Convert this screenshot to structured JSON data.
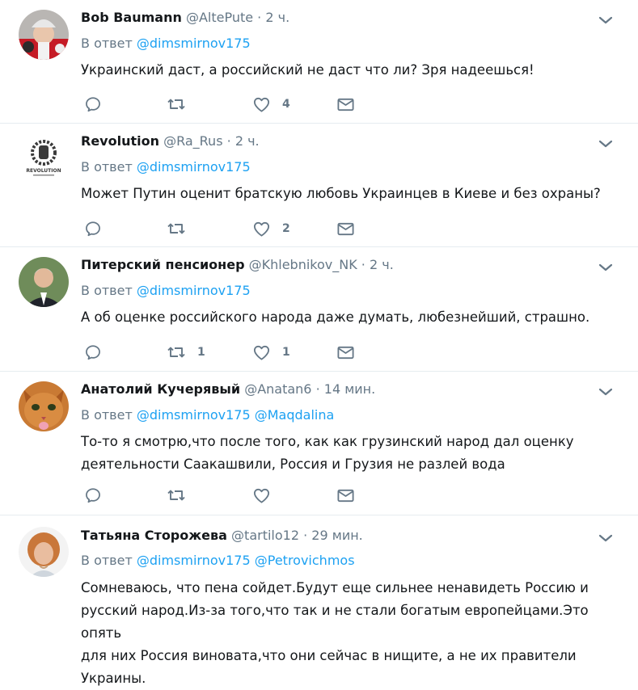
{
  "reply_prefix": "В ответ",
  "tweets": [
    {
      "name": "Bob Baumann",
      "handle": "@AltePute",
      "dot": "·",
      "time": "2 ч.",
      "mentions": [
        "@dimsmirnov175"
      ],
      "text": "Украинский даст, а российский не даст что ли? Зря надеешься!",
      "reply_count": "",
      "retweet_count": "",
      "like_count": "4"
    },
    {
      "name": "Revolution",
      "handle": "@Ra_Rus",
      "dot": "·",
      "time": "2 ч.",
      "mentions": [
        "@dimsmirnov175"
      ],
      "text": "Может Путин оценит братскую любовь Украинцев в Киеве и без охраны?",
      "avatar_caption": "REVOLUTION",
      "reply_count": "",
      "retweet_count": "",
      "like_count": "2"
    },
    {
      "name": "Питерский пенсионер",
      "handle": "@Khlebnikov_NK",
      "dot": "·",
      "time": "2 ч.",
      "mentions": [
        "@dimsmirnov175"
      ],
      "text": "А об оценке российского народа даже думать, любезнейший, страшно.",
      "reply_count": "",
      "retweet_count": "1",
      "like_count": "1"
    },
    {
      "name": "Анатолий Кучерявый",
      "handle": "@Anatan6",
      "dot": "·",
      "time": "14 мин.",
      "mentions": [
        "@dimsmirnov175",
        "@Maqdalina"
      ],
      "text_lines": [
        "То-то я смотрю,что после того, как как грузинский народ дал оценку",
        "деятельности Саакашвили,  Россия и Грузия не разлей вода"
      ],
      "reply_count": "",
      "retweet_count": "",
      "like_count": ""
    },
    {
      "name": "Татьяна Сторожева",
      "handle": "@tartilo12",
      "dot": "·",
      "time": "29 мин.",
      "mentions": [
        "@dimsmirnov175",
        "@Petrovichmos"
      ],
      "text_lines": [
        "Сомневаюсь, что пена сойдет.Будут еще сильнее ненавидеть Россию и",
        "русский народ.Из-за того,что так и не стали богатым европейцами.Это опять",
        "для них Россия виновата,что они сейчас в нищите, а не их правители",
        "Украины."
      ]
    }
  ],
  "icons": {
    "reply": "reply-icon",
    "retweet": "retweet-icon",
    "like": "heart-icon",
    "dm": "envelope-icon",
    "menu": "chevron-down-icon"
  },
  "colors": {
    "link": "#1da1f2",
    "muted": "#657786",
    "text": "#14171a",
    "divider": "#e6ecf0"
  }
}
